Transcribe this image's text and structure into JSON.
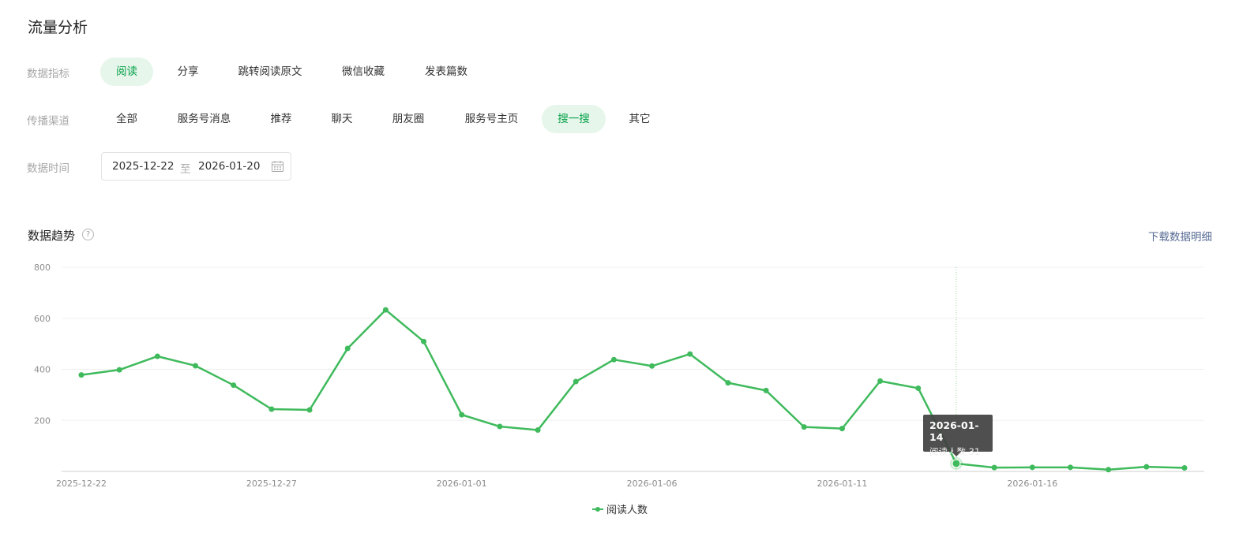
{
  "page_title": "流量分析",
  "filters": {
    "metric": {
      "label": "数据指标",
      "options": [
        "阅读",
        "分享",
        "跳转阅读原文",
        "微信收藏",
        "发表篇数"
      ],
      "selected": "阅读"
    },
    "channel": {
      "label": "传播渠道",
      "options": [
        "全部",
        "服务号消息",
        "推荐",
        "聊天",
        "朋友圈",
        "服务号主页",
        "搜一搜",
        "其它"
      ],
      "selected": "搜一搜"
    },
    "time": {
      "label": "数据时间",
      "start": "2025-12-22",
      "separator": "至",
      "end": "2026-01-20",
      "icon": "calendar-icon"
    }
  },
  "trend": {
    "title": "数据趋势",
    "help_icon": "question-circle-icon",
    "download_label": "下载数据明细"
  },
  "tooltip": {
    "date": "2026-01-14",
    "series_label": "阅读人数",
    "value": "31"
  },
  "colors": {
    "accent": "#07a14b",
    "line": "#3fba5c",
    "active_pill_bg": "#e6f6ea",
    "link": "#576b95"
  },
  "chart_data": {
    "type": "line",
    "title": "",
    "xlabel": "",
    "ylabel": "",
    "ylim": [
      0,
      800
    ],
    "yticks": [
      200,
      400,
      600,
      800
    ],
    "grid": true,
    "legend": "bottom-center",
    "x": [
      "2025-12-22",
      "2025-12-23",
      "2025-12-24",
      "2025-12-25",
      "2025-12-26",
      "2025-12-27",
      "2025-12-28",
      "2025-12-29",
      "2025-12-30",
      "2025-12-31",
      "2026-01-01",
      "2026-01-02",
      "2026-01-03",
      "2026-01-04",
      "2026-01-05",
      "2026-01-06",
      "2026-01-07",
      "2026-01-08",
      "2026-01-09",
      "2026-01-10",
      "2026-01-11",
      "2026-01-12",
      "2026-01-13",
      "2026-01-14",
      "2026-01-15",
      "2026-01-16",
      "2026-01-17",
      "2026-01-18",
      "2026-01-19",
      "2026-01-20"
    ],
    "xtick_labels": [
      "2025-12-22",
      "2025-12-27",
      "2026-01-01",
      "2026-01-06",
      "2026-01-11",
      "2026-01-16"
    ],
    "series": [
      {
        "name": "阅读人数",
        "values": [
          378,
          398,
          451,
          414,
          338,
          244,
          241,
          482,
          633,
          509,
          222,
          176,
          162,
          352,
          438,
          413,
          460,
          347,
          317,
          174,
          168,
          354,
          326,
          31,
          15,
          16,
          16,
          7,
          18,
          14
        ]
      }
    ],
    "highlight_index": 23
  }
}
